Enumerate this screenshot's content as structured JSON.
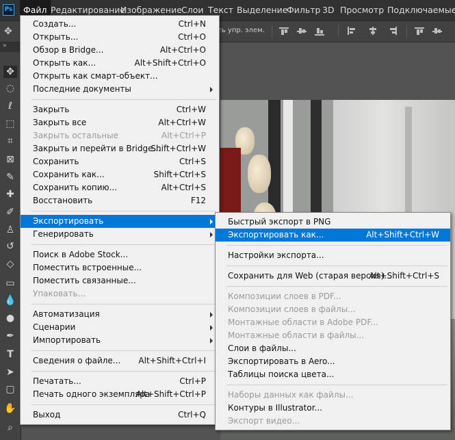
{
  "app": {
    "logo_text": "Ps"
  },
  "menubar": [
    {
      "label": "Файл",
      "active": true
    },
    {
      "label": "Редактирование"
    },
    {
      "label": "Изображение"
    },
    {
      "label": "Слои"
    },
    {
      "label": "Текст"
    },
    {
      "label": "Выделение"
    },
    {
      "label": "Фильтр"
    },
    {
      "label": "3D"
    },
    {
      "label": "Просмотр"
    },
    {
      "label": "Подключаемые м"
    }
  ],
  "options_bar": {
    "text": "ть упр. элем."
  },
  "tabbar": {
    "collapse": "»"
  },
  "toolbar": {
    "tools": [
      "move-tool",
      "marquee-tool",
      "lasso-tool",
      "object-select-tool",
      "crop-tool",
      "frame-tool",
      "eyedropper-tool",
      "healing-brush-tool",
      "brush-tool",
      "clone-stamp-tool",
      "history-brush-tool",
      "eraser-tool",
      "gradient-tool",
      "blur-tool",
      "dodge-tool",
      "pen-tool",
      "type-tool",
      "path-select-tool",
      "rectangle-tool",
      "hand-tool",
      "zoom-tool"
    ]
  },
  "file_menu": {
    "groups": [
      [
        {
          "label": "Создать...",
          "shortcut": "Ctrl+N"
        },
        {
          "label": "Открыть...",
          "shortcut": "Ctrl+O"
        },
        {
          "label": "Обзор в Bridge...",
          "shortcut": "Alt+Ctrl+O"
        },
        {
          "label": "Открыть как...",
          "shortcut": "Alt+Shift+Ctrl+O"
        },
        {
          "label": "Открыть как смарт-объект...",
          "shortcut": ""
        },
        {
          "label": "Последние документы",
          "shortcut": "",
          "submenu": true
        }
      ],
      [
        {
          "label": "Закрыть",
          "shortcut": "Ctrl+W"
        },
        {
          "label": "Закрыть все",
          "shortcut": "Alt+Ctrl+W"
        },
        {
          "label": "Закрыть остальные",
          "shortcut": "Alt+Ctrl+P",
          "disabled": true
        },
        {
          "label": "Закрыть и перейти в Bridge...",
          "shortcut": "Shift+Ctrl+W"
        },
        {
          "label": "Сохранить",
          "shortcut": "Ctrl+S"
        },
        {
          "label": "Сохранить как...",
          "shortcut": "Shift+Ctrl+S"
        },
        {
          "label": "Сохранить копию...",
          "shortcut": "Alt+Ctrl+S"
        },
        {
          "label": "Восстановить",
          "shortcut": "F12"
        }
      ],
      [
        {
          "label": "Экспортировать",
          "shortcut": "",
          "submenu": true,
          "highlighted": true
        },
        {
          "label": "Генерировать",
          "shortcut": "",
          "submenu": true
        }
      ],
      [
        {
          "label": "Поиск в Adobe Stock...",
          "shortcut": ""
        },
        {
          "label": "Поместить встроенные...",
          "shortcut": ""
        },
        {
          "label": "Поместить связанные...",
          "shortcut": ""
        },
        {
          "label": "Упаковать...",
          "shortcut": "",
          "disabled": true
        }
      ],
      [
        {
          "label": "Автоматизация",
          "shortcut": "",
          "submenu": true
        },
        {
          "label": "Сценарии",
          "shortcut": "",
          "submenu": true
        },
        {
          "label": "Импортировать",
          "shortcut": "",
          "submenu": true
        }
      ],
      [
        {
          "label": "Сведения о файле...",
          "shortcut": "Alt+Shift+Ctrl+I"
        }
      ],
      [
        {
          "label": "Печатать...",
          "shortcut": "Ctrl+P"
        },
        {
          "label": "Печать одного экземпляра",
          "shortcut": "Alt+Shift+Ctrl+P"
        }
      ],
      [
        {
          "label": "Выход",
          "shortcut": "Ctrl+Q"
        }
      ]
    ]
  },
  "export_submenu": {
    "groups": [
      [
        {
          "label": "Быстрый экспорт в PNG",
          "shortcut": ""
        },
        {
          "label": "Экспортировать как...",
          "shortcut": "Alt+Shift+Ctrl+W",
          "highlighted": true
        }
      ],
      [
        {
          "label": "Настройки экспорта...",
          "shortcut": ""
        }
      ],
      [
        {
          "label": "Сохранить для Web (старая версия)...",
          "shortcut": "Alt+Shift+Ctrl+S"
        }
      ],
      [
        {
          "label": "Композиции слоев в PDF...",
          "shortcut": "",
          "disabled": true
        },
        {
          "label": "Композиции слоев в файлы...",
          "shortcut": "",
          "disabled": true
        },
        {
          "label": "Монтажные области в Adobe PDF...",
          "shortcut": "",
          "disabled": true
        },
        {
          "label": "Монтажные области в файлы...",
          "shortcut": "",
          "disabled": true
        },
        {
          "label": "Слои в файлы...",
          "shortcut": ""
        },
        {
          "label": "Экспортировать в Aero...",
          "shortcut": ""
        },
        {
          "label": "Таблицы поиска цвета...",
          "shortcut": ""
        }
      ],
      [
        {
          "label": "Наборы данных как файлы...",
          "shortcut": "",
          "disabled": true
        },
        {
          "label": "Контуры в Illustrator...",
          "shortcut": ""
        },
        {
          "label": "Экспорт видео...",
          "shortcut": "",
          "disabled": true
        }
      ]
    ]
  }
}
